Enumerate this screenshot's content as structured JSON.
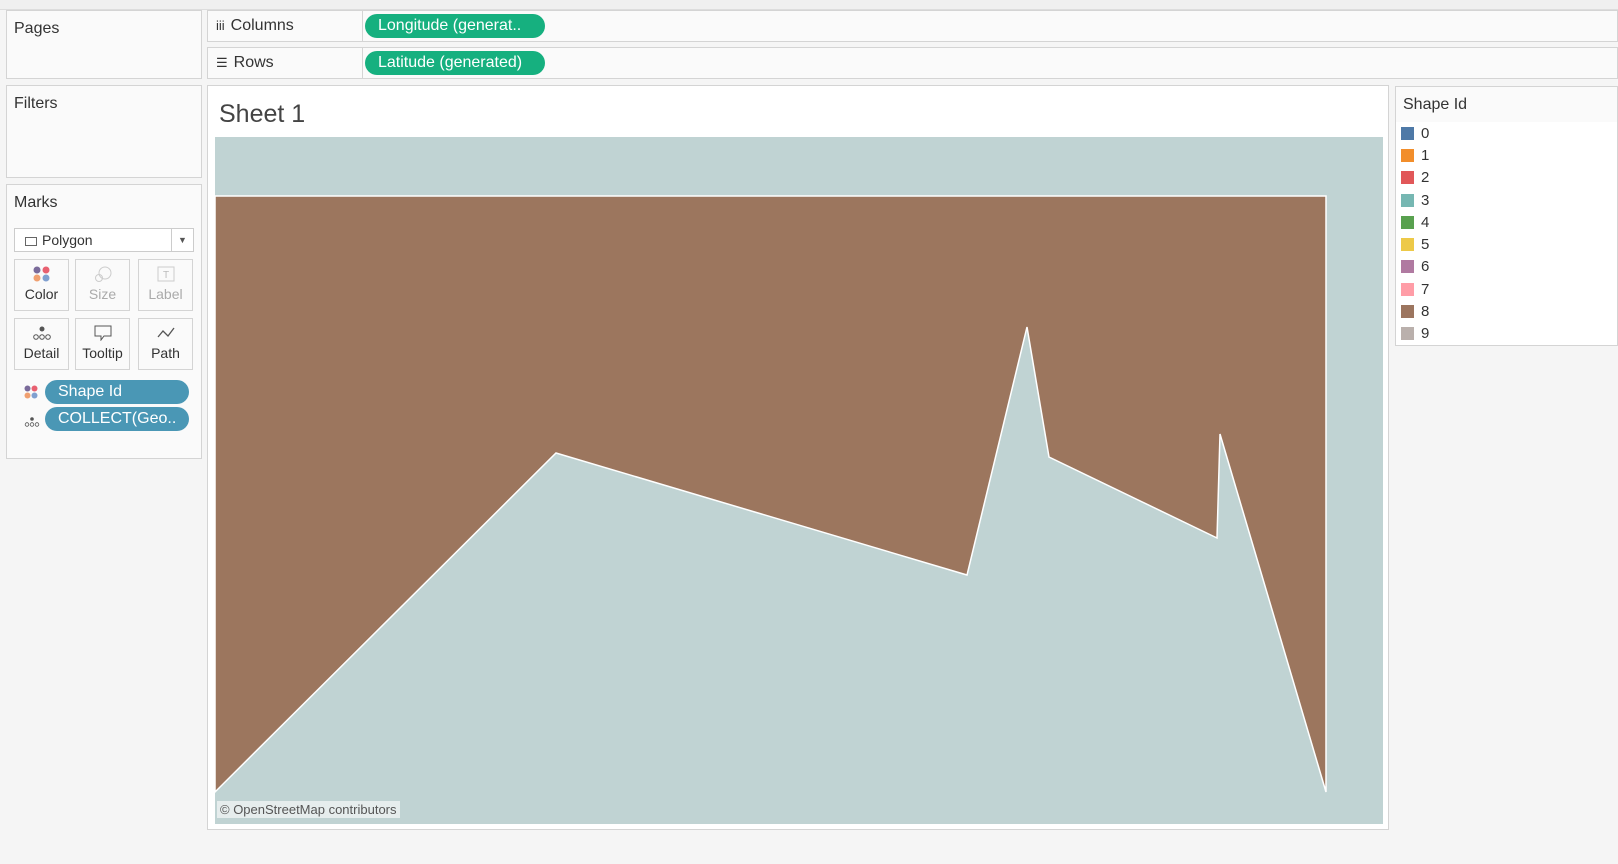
{
  "pages": {
    "title": "Pages"
  },
  "filters": {
    "title": "Filters"
  },
  "marks": {
    "title": "Marks",
    "type": "Polygon",
    "buttons": {
      "color": "Color",
      "size": "Size",
      "label": "Label",
      "detail": "Detail",
      "tooltip": "Tooltip",
      "path": "Path"
    },
    "fields": [
      {
        "label": "Shape Id",
        "encoding": "color"
      },
      {
        "label": "COLLECT(Geo..",
        "encoding": "detail"
      }
    ]
  },
  "shelves": {
    "columns": {
      "label": "Columns",
      "pill": "Longitude (generat.."
    },
    "rows": {
      "label": "Rows",
      "pill": "Latitude (generated)"
    }
  },
  "sheet": {
    "title": "Sheet 1",
    "attribution": "© OpenStreetMap contributors",
    "map_color": "#c0d3d3",
    "polygon_color": "#9c765e"
  },
  "legend": {
    "title": "Shape Id",
    "items": [
      {
        "label": "0",
        "color": "#4e79a7"
      },
      {
        "label": "1",
        "color": "#f28e2b"
      },
      {
        "label": "2",
        "color": "#e15759"
      },
      {
        "label": "3",
        "color": "#76b7b2"
      },
      {
        "label": "4",
        "color": "#59a14f"
      },
      {
        "label": "5",
        "color": "#edc948"
      },
      {
        "label": "6",
        "color": "#b07aa1"
      },
      {
        "label": "7",
        "color": "#ff9da7"
      },
      {
        "label": "8",
        "color": "#9c755f"
      },
      {
        "label": "9",
        "color": "#bab0ac"
      }
    ]
  }
}
